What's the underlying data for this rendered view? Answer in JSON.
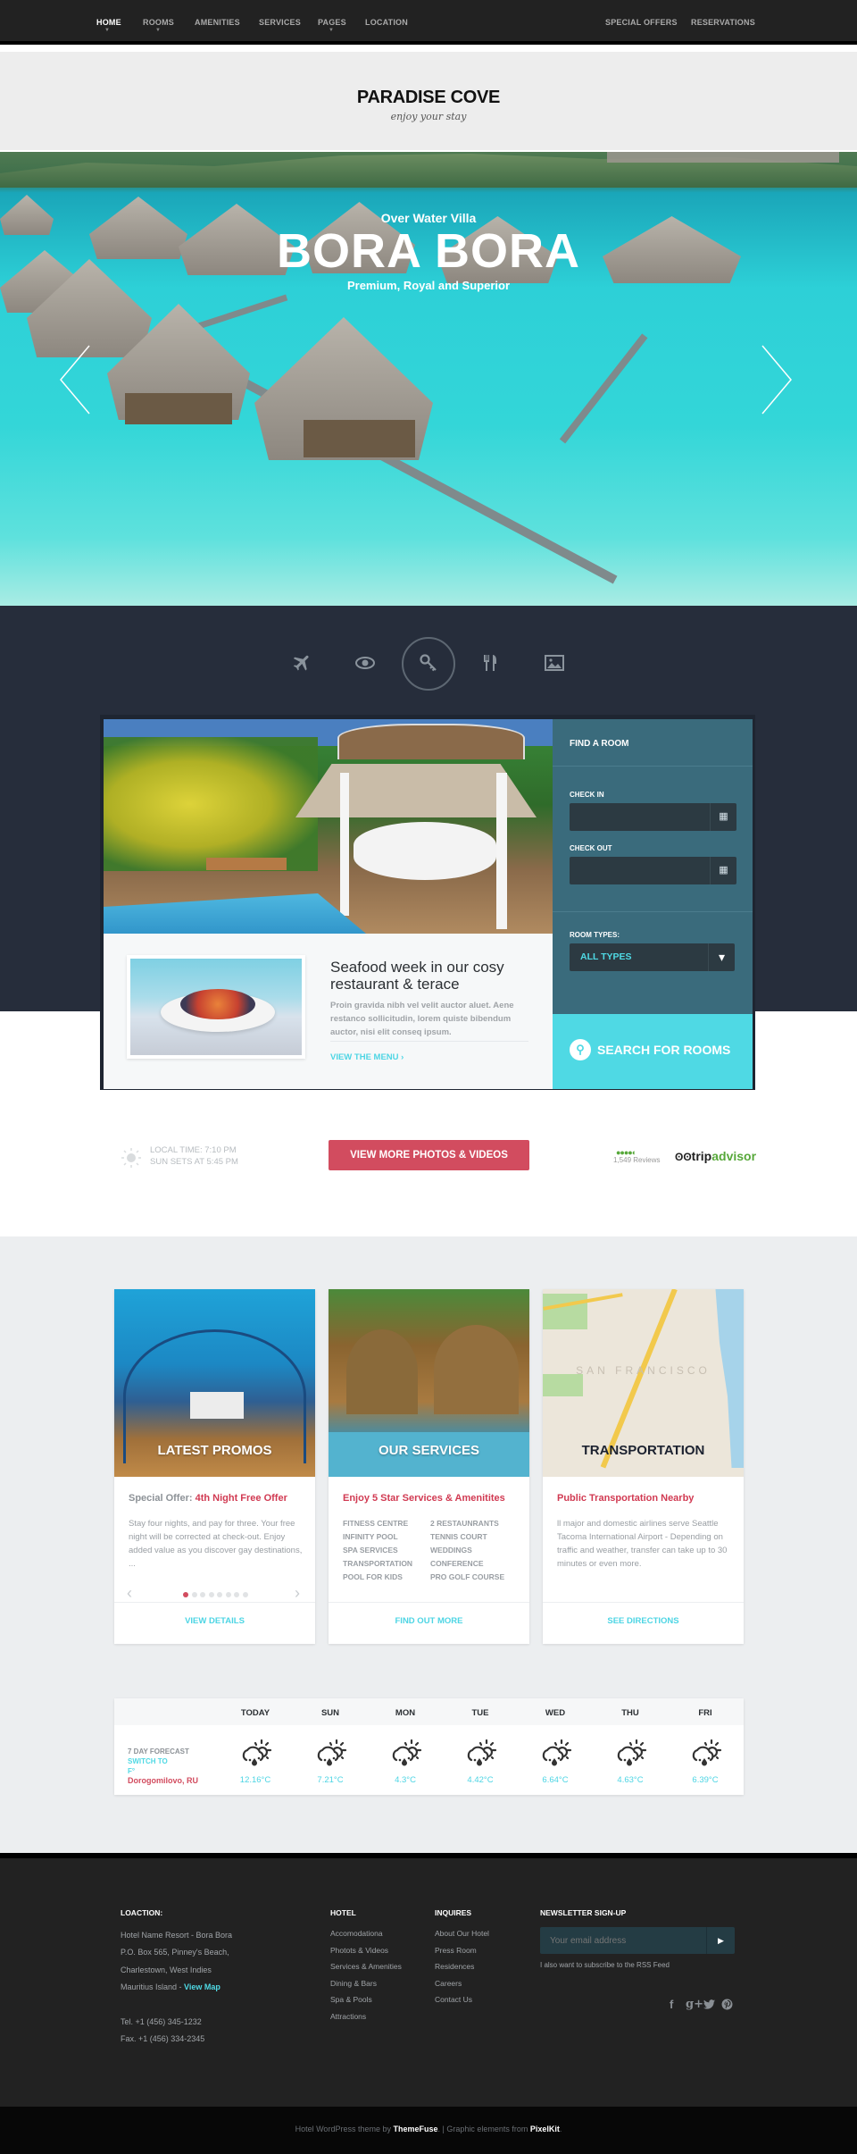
{
  "nav": {
    "left_items": [
      {
        "label": "HOME",
        "active": true,
        "has_caret": true
      },
      {
        "label": "ROOMS",
        "active": false,
        "has_caret": true
      },
      {
        "label": "AMENITIES",
        "active": false,
        "has_caret": false
      },
      {
        "label": "SERVICES",
        "active": false,
        "has_caret": false
      },
      {
        "label": "PAGES",
        "active": false,
        "has_caret": true
      },
      {
        "label": "LOCATION",
        "active": false,
        "has_caret": false
      }
    ],
    "right_items": [
      {
        "label": "SPECIAL OFFERS"
      },
      {
        "label": "RESERVATIONS"
      }
    ],
    "caret_glyph": "▼"
  },
  "brand": {
    "logo": "PARADISE COVE",
    "tagline": "enjoy your stay"
  },
  "hero": {
    "subtitle": "Over Water Villa",
    "title": "BORA BORA",
    "caption": "Premium, Royal and Superior",
    "prev_icon": "chevron-left-icon",
    "next_icon": "chevron-right-icon"
  },
  "feature_icons": [
    {
      "name": "airplane-icon",
      "glyph": "✈",
      "active": false
    },
    {
      "name": "eye-icon",
      "glyph": "◉",
      "active": false
    },
    {
      "name": "key-icon",
      "glyph": "⚷",
      "active": true
    },
    {
      "name": "dining-icon",
      "glyph": "🍴",
      "active": false
    },
    {
      "name": "picture-icon",
      "glyph": "▣",
      "active": false
    }
  ],
  "promo": {
    "title": "Seafood week in our cosy restaurant & terace",
    "text": "Proin gravida nibh vel velit auctor aluet. Aene restanco sollicitudin, lorem quiste bibendum auctor, nisi elit conseq ipsum.",
    "link": "VIEW THE MENU",
    "link_arrow": "›"
  },
  "find_room": {
    "title": "FIND A ROOM",
    "check_in_label": "CHECK IN",
    "check_in_value": "",
    "check_out_label": "CHECK OUT",
    "check_out_value": "",
    "calendar_glyph": "▦",
    "room_types_label": "ROOM TYPES:",
    "room_type_selected": "ALL TYPES",
    "dropdown_glyph": "▾",
    "search_label": "SEARCH FOR ROOMS",
    "search_glyph": "⚲"
  },
  "info_row": {
    "local_time": "LOCAL TIME: 7:10 PM",
    "sunset": "SUN SETS AT 5:45 PM",
    "more_button": "VIEW MORE PHOTOS & VIDEOS",
    "rating_circles": "●●●●◐",
    "reviews": "1,549 Reviews",
    "tripadvisor_a": "trip",
    "tripadvisor_b": "advisor",
    "tripadvisor_owl": "ʘʘ"
  },
  "feature_cards": [
    {
      "image_title": "LATEST PROMOS",
      "title_prefix": "Special Offer: ",
      "title": "4th Night Free Offer",
      "text": "Stay four nights, and pay for three. Your free night will be corrected at check-out. Enjoy added value as you discover gay destinations, ...",
      "link": "VIEW DETAILS",
      "slider": {
        "prev": "‹",
        "next": "›",
        "dots": 8,
        "active_dot": 1
      }
    },
    {
      "image_title": "OUR SERVICES",
      "title": "Enjoy 5 Star Services & Amenitites",
      "services_left": [
        "FITNESS CENTRE",
        "INFINITY POOL",
        "SPA SERVICES",
        "TRANSPORTATION",
        "POOL FOR KIDS"
      ],
      "services_right": [
        "2 RESTAUNRANTS",
        "TENNIS COURT",
        "WEDDINGS",
        "CONFERENCE",
        "PRO GOLF COURSE"
      ],
      "link": "FIND OUT MORE"
    },
    {
      "image_title": "TRANSPORTATION",
      "map_label": "SAN FRANCISCO",
      "title": "Public Transportation Nearby",
      "text": "ll major and domestic airlines serve Seattle Tacoma International Airport - Depending on traffic and weather, transfer can take up to 30 minutes or even more.",
      "link": "SEE DIRECTIONS"
    }
  ],
  "weather": {
    "label": "7 DAY FORECAST",
    "switch_label": "SWITCH TO",
    "switch_unit": "F°",
    "location": "Dorogomilovo, RU",
    "days": [
      {
        "day": "TODAY",
        "temp": "12.16°C"
      },
      {
        "day": "SUN",
        "temp": "7.21°C"
      },
      {
        "day": "MON",
        "temp": "4.3°C"
      },
      {
        "day": "TUE",
        "temp": "4.42°C"
      },
      {
        "day": "WED",
        "temp": "6.64°C"
      },
      {
        "day": "THU",
        "temp": "4.63°C"
      },
      {
        "day": "FRI",
        "temp": "6.39°C"
      }
    ]
  },
  "footer": {
    "location_heading": "LOACTION:",
    "address": [
      "Hotel Name Resort - Bora Bora",
      "P.O. Box 565, Pinney's Beach,",
      "Charlestown, West Indies"
    ],
    "address_last": "Mauritius Island - ",
    "view_map": "View Map",
    "tel": "Tel. +1 (456) 345-1232",
    "fax": "Fax. +1 (456) 334-2345",
    "hotel_heading": "HOTEL",
    "hotel_links": [
      "Accomodationa",
      "Photots & Videos",
      "Services & Amenities",
      "Dining & Bars",
      "Spa & Pools",
      "Attractions"
    ],
    "inquires_heading": "INQUIRES",
    "inquires_links": [
      "About Our Hotel",
      "Press Room",
      "Residences",
      "Careers",
      "Contact Us"
    ],
    "newsletter_heading": "NEWSLETTER SIGN-UP",
    "newsletter_placeholder": "Your email address",
    "newsletter_submit": "▶",
    "rss_text": "I also want to subscribe to the RSS Feed",
    "social": [
      {
        "name": "facebook-icon",
        "glyph": "f"
      },
      {
        "name": "google-plus-icon",
        "glyph": "g+"
      },
      {
        "name": "twitter-icon",
        "glyph": "🐦"
      },
      {
        "name": "pinterest-icon",
        "glyph": "℗"
      }
    ]
  },
  "credits": {
    "prefix": "Hotel WordPress theme by ",
    "themefuse": "ThemeFuse",
    "middle": ". | Graphic elements from ",
    "pixelkit": "PixelKit",
    "suffix": "."
  },
  "colors": {
    "accent_cyan": "#4fd9e4",
    "accent_red": "#d24c5f",
    "find_room_bg": "#3a6b7c",
    "dark_band": "#262d3b",
    "footer_bg": "#222222"
  }
}
